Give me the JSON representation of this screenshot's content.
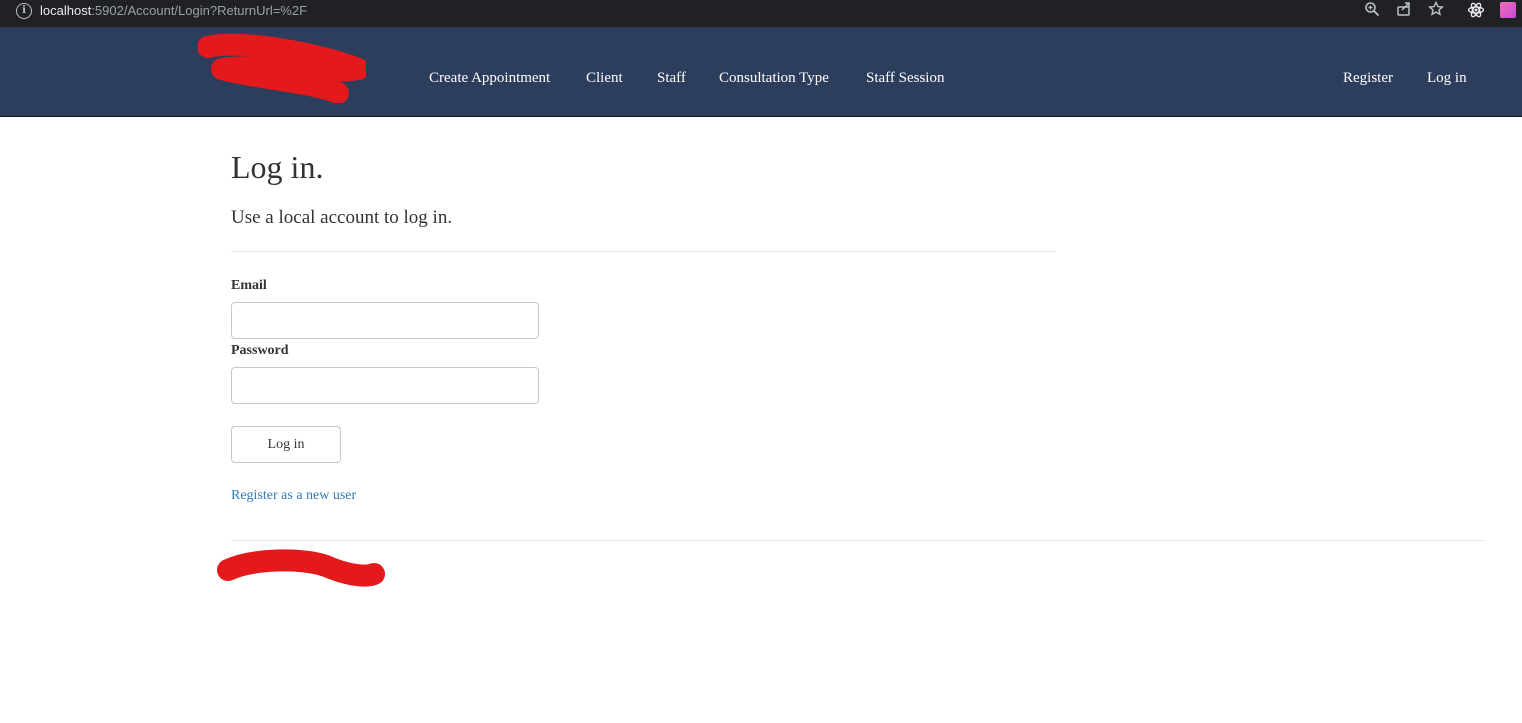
{
  "browser": {
    "url_host": "localhost",
    "url_path": ":5902/Account/Login?ReturnUrl=%2F",
    "icons": [
      "info-icon",
      "zoom-icon",
      "share-icon",
      "bookmark-star-icon",
      "extension-icon",
      "profile-icon"
    ]
  },
  "navbar": {
    "background": "#2c3e5c",
    "links": [
      {
        "label": "Create Appointment"
      },
      {
        "label": "Client"
      },
      {
        "label": "Staff"
      },
      {
        "label": "Consultation Type"
      },
      {
        "label": "Staff Session"
      }
    ],
    "right_links": [
      {
        "label": "Register"
      },
      {
        "label": "Log in"
      }
    ]
  },
  "login": {
    "title": "Log in.",
    "subtitle": "Use a local account to log in.",
    "email_label": "Email",
    "email_value": "",
    "password_label": "Password",
    "password_value": "",
    "submit_label": "Log in",
    "register_link": "Register as a new user",
    "link_color": "#337ab7"
  }
}
